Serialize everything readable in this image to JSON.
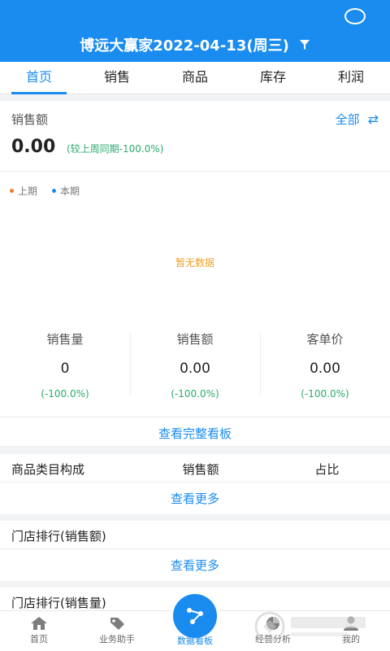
{
  "header": {
    "title": "博远大赢家2022-04-13(周三)"
  },
  "tabs": [
    {
      "label": "首页",
      "active": true
    },
    {
      "label": "销售",
      "active": false
    },
    {
      "label": "商品",
      "active": false
    },
    {
      "label": "库存",
      "active": false
    },
    {
      "label": "利润",
      "active": false
    }
  ],
  "sales": {
    "title": "销售额",
    "all_label": "全部",
    "value": "0.00",
    "compare": "(较上周同期-100.0%)",
    "legend": [
      {
        "label": "上期",
        "color": "#f07b2b"
      },
      {
        "label": "本期",
        "color": "#1a8cf0"
      }
    ],
    "no_data": "暂无数据",
    "metrics": [
      {
        "label": "销售量",
        "value": "0",
        "change": "(-100.0%)"
      },
      {
        "label": "销售额",
        "value": "0.00",
        "change": "(-100.0%)"
      },
      {
        "label": "客单价",
        "value": "0.00",
        "change": "(-100.0%)"
      }
    ],
    "view_full": "查看完整看板"
  },
  "category": {
    "columns": [
      "商品类目构成",
      "销售额",
      "占比"
    ],
    "view_more": "查看更多"
  },
  "store_amount": {
    "title": "门店排行(销售额)",
    "view_more": "查看更多"
  },
  "store_qty": {
    "title": "门店排行(销售量)"
  },
  "bottom_nav": [
    {
      "label": "首页",
      "icon": "home-icon"
    },
    {
      "label": "业务助手",
      "icon": "tag-icon"
    },
    {
      "label": "数据看板",
      "icon": "data-board-icon",
      "active": true
    },
    {
      "label": "经营分析",
      "icon": "analysis-icon"
    },
    {
      "label": "我的",
      "icon": "user-icon"
    }
  ],
  "colors": {
    "accent": "#1a8cf0",
    "positive": "#2cab6c",
    "warning": "#f0a020"
  }
}
